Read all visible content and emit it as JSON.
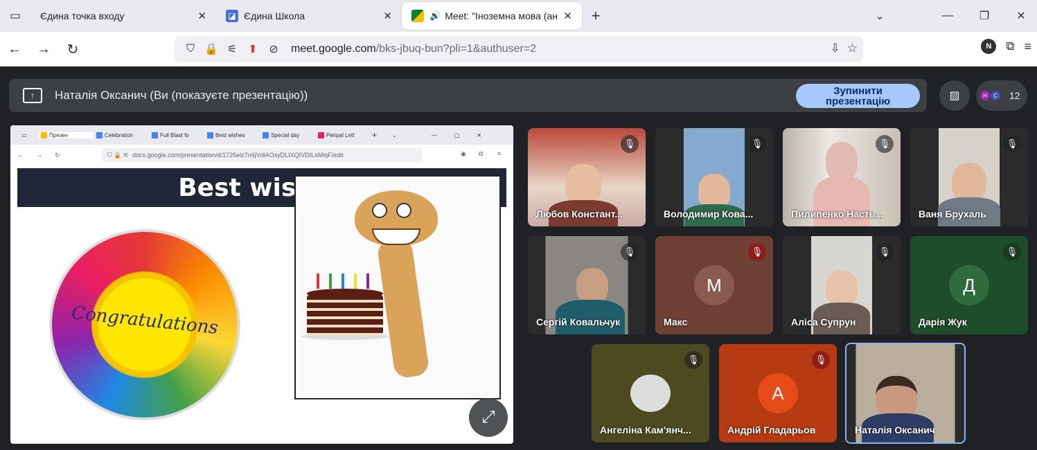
{
  "browser": {
    "tabs": [
      {
        "title": "Єдина точка входу",
        "close": "✕"
      },
      {
        "title": "Єдина Школа",
        "close": "✕"
      },
      {
        "title": "Meet: \"Іноземна мова (анг",
        "close": "✕"
      }
    ],
    "new_tab": "+",
    "url_host": "meet.google.com",
    "url_path": "/bks-jbuq-bun?pli=1&authuser=2",
    "account_initial": "N"
  },
  "meet": {
    "presenting_text": "Наталія Оксанич (Ви (показуєте презентацію))",
    "stop_button_line1": "Зупинити",
    "stop_button_line2": "презентацію",
    "participant_count": "12",
    "mini_avatars": [
      "H",
      "C"
    ],
    "presentation": {
      "mini_tabs": [
        "Презен",
        "Celebration",
        "Full Blast fo",
        "Best wishes",
        "Special day",
        "Penpal Lett"
      ],
      "mini_url": "docs.google.com/presentation/d/1725elz7n6jVdlAOxyDLIXQIVDILsMiqF/edit",
      "slide_title": "Best wishes",
      "balloon_text": "Congratulations"
    },
    "participants": [
      {
        "name": "Любов Констант...",
        "muted": true,
        "type": "video"
      },
      {
        "name": "Володимир Кова...",
        "muted": true,
        "type": "video"
      },
      {
        "name": "Пилипенко Насть...",
        "muted": true,
        "type": "video"
      },
      {
        "name": "Ваня Брухаль",
        "muted": true,
        "type": "video"
      },
      {
        "name": "Сергій Ковальчук",
        "muted": true,
        "type": "video"
      },
      {
        "name": "Макс",
        "muted": true,
        "type": "avatar",
        "initial": "М"
      },
      {
        "name": "Аліса Супрун",
        "muted": true,
        "type": "video"
      },
      {
        "name": "Дарія Жук",
        "muted": true,
        "type": "avatar",
        "initial": "Д"
      },
      {
        "name": "Ангеліна Кам'янч...",
        "muted": true,
        "type": "video"
      },
      {
        "name": "Андрій Гладарьов",
        "muted": true,
        "type": "avatar",
        "initial": "А"
      },
      {
        "name": "Наталія Оксанич",
        "muted": false,
        "type": "video"
      }
    ]
  },
  "colors": {
    "meet_bg": "#202124",
    "stop_button": "#a8c7fa",
    "maks_tile": "#6e3f33",
    "daria_tile": "#1e4d2b",
    "andrii_tile": "#b63b12"
  }
}
